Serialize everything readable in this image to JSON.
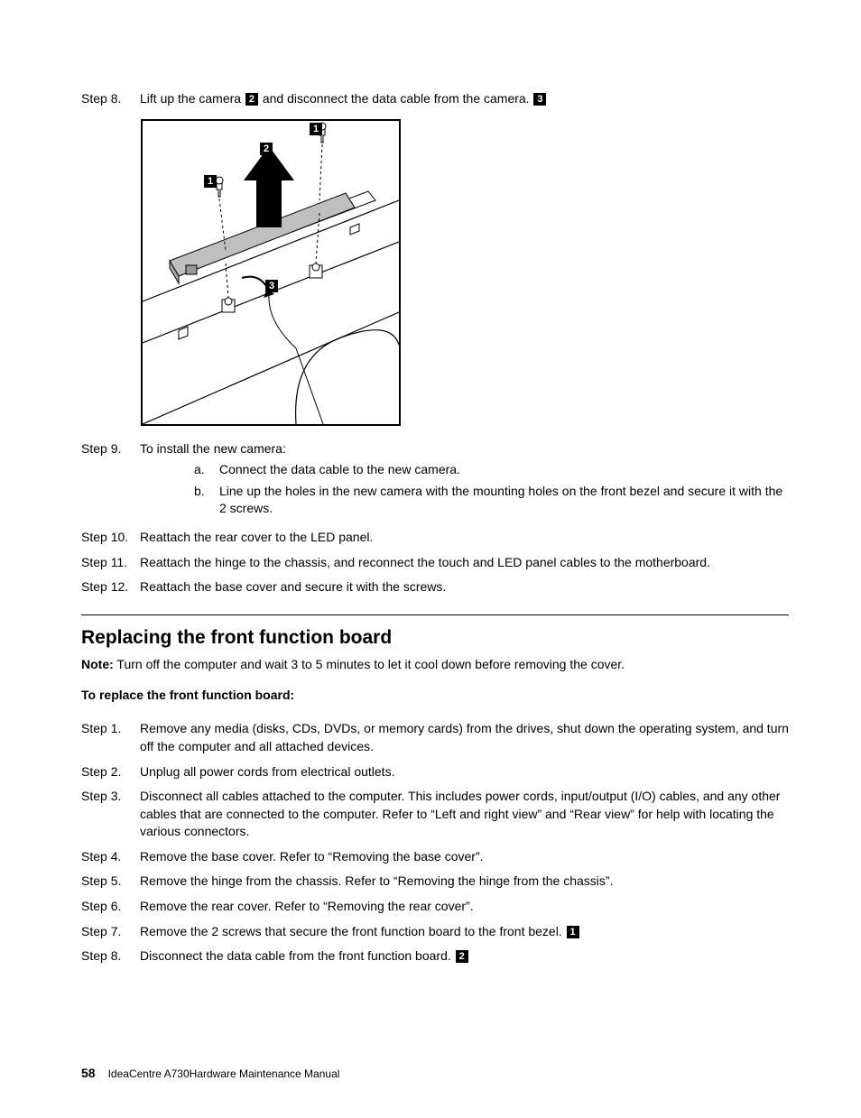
{
  "step8": {
    "label": "Step 8.",
    "text_a": "Lift up the camera ",
    "callout_a": "2",
    "text_b": " and disconnect the data cable from the camera. ",
    "callout_b": "3"
  },
  "figure": {
    "callouts": {
      "c1a": "1",
      "c1b": "1",
      "c2": "2",
      "c3": "3"
    }
  },
  "step9": {
    "label": "Step 9.",
    "intro": "To install the new camera:",
    "a_label": "a.",
    "a_text": "Connect the data cable to the new camera.",
    "b_label": "b.",
    "b_text": "Line up the holes in the new camera with the mounting holes on the front bezel and secure it with the 2 screws."
  },
  "step10": {
    "label": "Step 10.",
    "text": "Reattach the rear cover to the LED panel."
  },
  "step11": {
    "label": "Step 11.",
    "text": "Reattach the hinge to the chassis, and reconnect the touch and LED panel cables to the motherboard."
  },
  "step12": {
    "label": "Step 12.",
    "text": "Reattach the base cover and secure it with the screws."
  },
  "section": {
    "title": "Replacing the front function board",
    "note_label": "Note:",
    "note_text": " Turn off the computer and wait 3 to 5 minutes to let it cool down before removing the cover.",
    "proc_title": "To replace the front function board:"
  },
  "b_step1": {
    "label": "Step 1.",
    "text": "Remove any media (disks, CDs, DVDs, or memory cards) from the drives, shut down the operating system, and turn off the computer and all attached devices."
  },
  "b_step2": {
    "label": "Step 2.",
    "text": "Unplug all power cords from electrical outlets."
  },
  "b_step3": {
    "label": "Step 3.",
    "text": "Disconnect all cables attached to the computer. This includes power cords, input/output (I/O) cables, and any other cables that are connected to the computer. Refer to “Left and right view” and “Rear view” for help with locating the various connectors."
  },
  "b_step4": {
    "label": "Step 4.",
    "text": "Remove the base cover. Refer to “Removing the base cover”."
  },
  "b_step5": {
    "label": "Step 5.",
    "text": "Remove the hinge from the chassis. Refer to “Removing the hinge from the chassis”."
  },
  "b_step6": {
    "label": "Step 6.",
    "text": "Remove the rear cover. Refer to “Removing the rear cover”."
  },
  "b_step7": {
    "label": "Step 7.",
    "text_a": "Remove the 2 screws that secure the front function board to the front bezel. ",
    "callout": "1"
  },
  "b_step8": {
    "label": "Step 8.",
    "text_a": "Disconnect the data cable from the front function board. ",
    "callout": "2"
  },
  "footer": {
    "page": "58",
    "title": "IdeaCentre A730Hardware Maintenance Manual"
  }
}
